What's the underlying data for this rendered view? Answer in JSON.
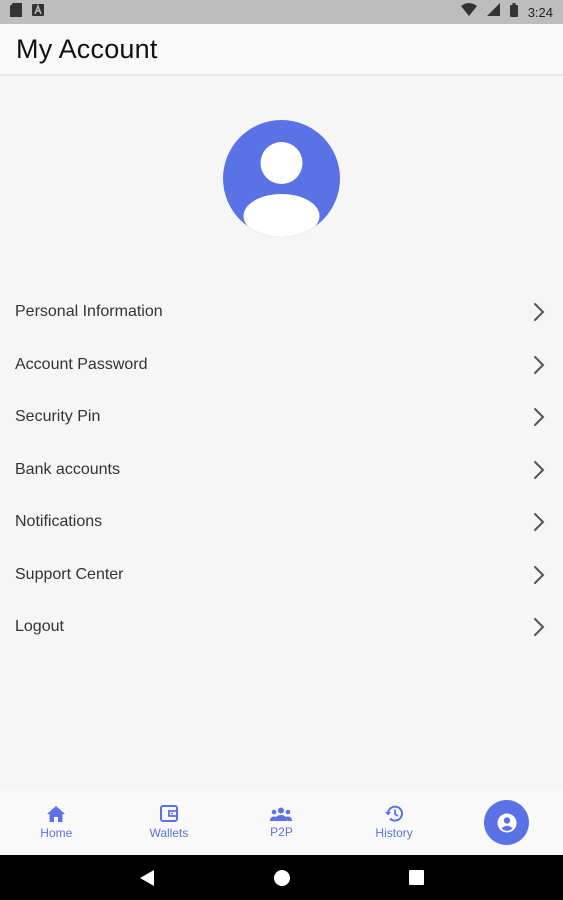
{
  "status_bar": {
    "time": "3:24",
    "icons": [
      "sd-card-icon",
      "a-notification-icon",
      "wifi-icon",
      "cell-signal-icon",
      "battery-icon"
    ]
  },
  "header": {
    "title": "My Account"
  },
  "profile": {
    "avatar_icon": "user-avatar-icon",
    "avatar_color": "#5a72e6"
  },
  "menu": {
    "items": [
      {
        "label": "Personal Information",
        "icon": "chevron-right-icon"
      },
      {
        "label": "Account Password",
        "icon": "chevron-right-icon"
      },
      {
        "label": "Security Pin",
        "icon": "chevron-right-icon"
      },
      {
        "label": "Bank accounts",
        "icon": "chevron-right-icon"
      },
      {
        "label": "Notifications",
        "icon": "chevron-right-icon"
      },
      {
        "label": "Support Center",
        "icon": "chevron-right-icon"
      },
      {
        "label": "Logout",
        "icon": "chevron-right-icon"
      }
    ]
  },
  "bottom_nav": {
    "items": [
      {
        "label": "Home",
        "icon": "home-icon"
      },
      {
        "label": "Wallets",
        "icon": "wallet-icon"
      },
      {
        "label": "P2P",
        "icon": "people-icon"
      },
      {
        "label": "History",
        "icon": "history-icon"
      },
      {
        "label": "",
        "icon": "account-circle-icon",
        "active": true
      }
    ],
    "accent": "#5a72e6"
  },
  "system_nav": {
    "icons": [
      "back-icon",
      "home-circle-icon",
      "recents-icon"
    ]
  }
}
